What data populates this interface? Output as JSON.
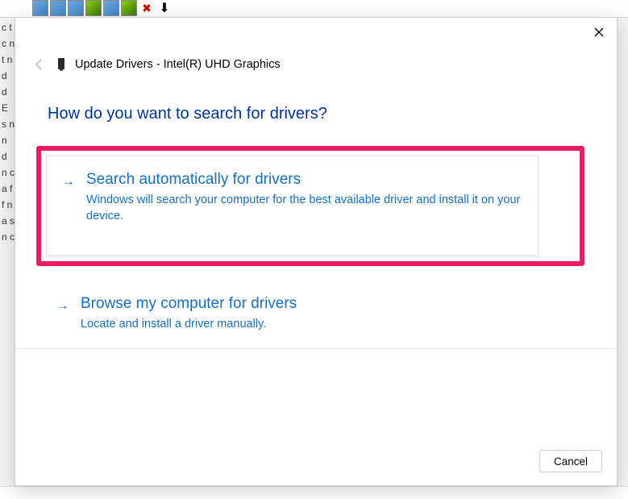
{
  "header": {
    "title_prefix": "Update Drivers - ",
    "device_name": "Intel(R) UHD Graphics"
  },
  "question": "How do you want to search for drivers?",
  "options": [
    {
      "title": "Search automatically for drivers",
      "description": "Windows will search your computer for the best available driver and install it on your device.",
      "highlighted": true
    },
    {
      "title": "Browse my computer for drivers",
      "description": "Locate and install a driver manually.",
      "highlighted": false
    }
  ],
  "footer": {
    "cancel_label": "Cancel"
  },
  "bg_fragment": "c t c n t n d d E s n n d n c a ff n a s n c"
}
